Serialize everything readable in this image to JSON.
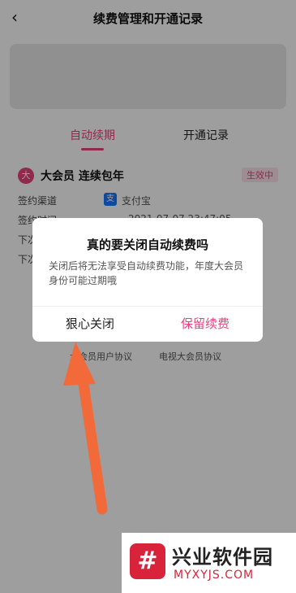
{
  "header": {
    "title": "续费管理和开通记录",
    "back_icon": "‹"
  },
  "tabs": [
    {
      "label": "自动续期"
    },
    {
      "label": "开通记录"
    }
  ],
  "card": {
    "icon_text": "大",
    "title": "大会员 连续包年",
    "status": "生效中",
    "rows": [
      {
        "label": "签约渠道",
        "value": "支付宝"
      },
      {
        "label": "签约时间",
        "value": "2021-07-07 23:47:05"
      },
      {
        "label": "下次",
        "value": ""
      },
      {
        "label": "下次",
        "value": ""
      }
    ]
  },
  "agreements": {
    "left": "大会员用户协议",
    "right": "电视大会员协议"
  },
  "dialog": {
    "title": "真的要关闭自动续费吗",
    "message": "关闭后将无法享受自动续费功能，年度大会员身份可能过期哦",
    "close_button": "狠心关闭",
    "keep_button": "保留续费"
  },
  "watermark": {
    "logo_text": "#",
    "title": "兴业软件园",
    "url": "MYXYJS.COM"
  },
  "colors": {
    "accent": "#e8447c",
    "arrow": "#f26a3a",
    "alipay": "#1677ff",
    "brand": "#d8233a"
  }
}
